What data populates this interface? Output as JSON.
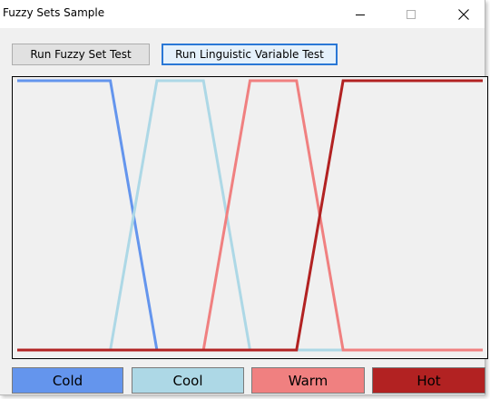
{
  "window": {
    "title": "Fuzzy Sets Sample"
  },
  "icons": {
    "minimize": "minimize-icon",
    "maximize": "maximize-icon",
    "close": "close-icon"
  },
  "buttons": {
    "fuzzy_set_test": "Run Fuzzy Set Test",
    "linguistic_variable_test": "Run Linguistic Variable Test"
  },
  "chart_data": {
    "type": "line",
    "title": "",
    "xlabel": "",
    "ylabel": "",
    "ylim": [
      0,
      1
    ],
    "xlim": [
      0,
      100
    ],
    "grid": false,
    "series": [
      {
        "name": "Cold",
        "color": "#6495ed",
        "x": [
          0,
          20,
          30,
          100
        ],
        "y": [
          1,
          1,
          0,
          0
        ]
      },
      {
        "name": "Cool",
        "color": "#add8e6",
        "x": [
          0,
          20,
          30,
          40,
          50,
          100
        ],
        "y": [
          0,
          0,
          1,
          1,
          0,
          0
        ]
      },
      {
        "name": "Warm",
        "color": "#f08080",
        "x": [
          0,
          40,
          50,
          60,
          70,
          100
        ],
        "y": [
          0,
          0,
          1,
          1,
          0,
          0
        ]
      },
      {
        "name": "Hot",
        "color": "#b22222",
        "x": [
          0,
          60,
          70,
          100
        ],
        "y": [
          0,
          0,
          1,
          1
        ]
      }
    ]
  },
  "legend": [
    {
      "label": "Cold",
      "color": "#6495ed"
    },
    {
      "label": "Cool",
      "color": "#add8e6"
    },
    {
      "label": "Warm",
      "color": "#f08080"
    },
    {
      "label": "Hot",
      "color": "#b22222"
    }
  ]
}
